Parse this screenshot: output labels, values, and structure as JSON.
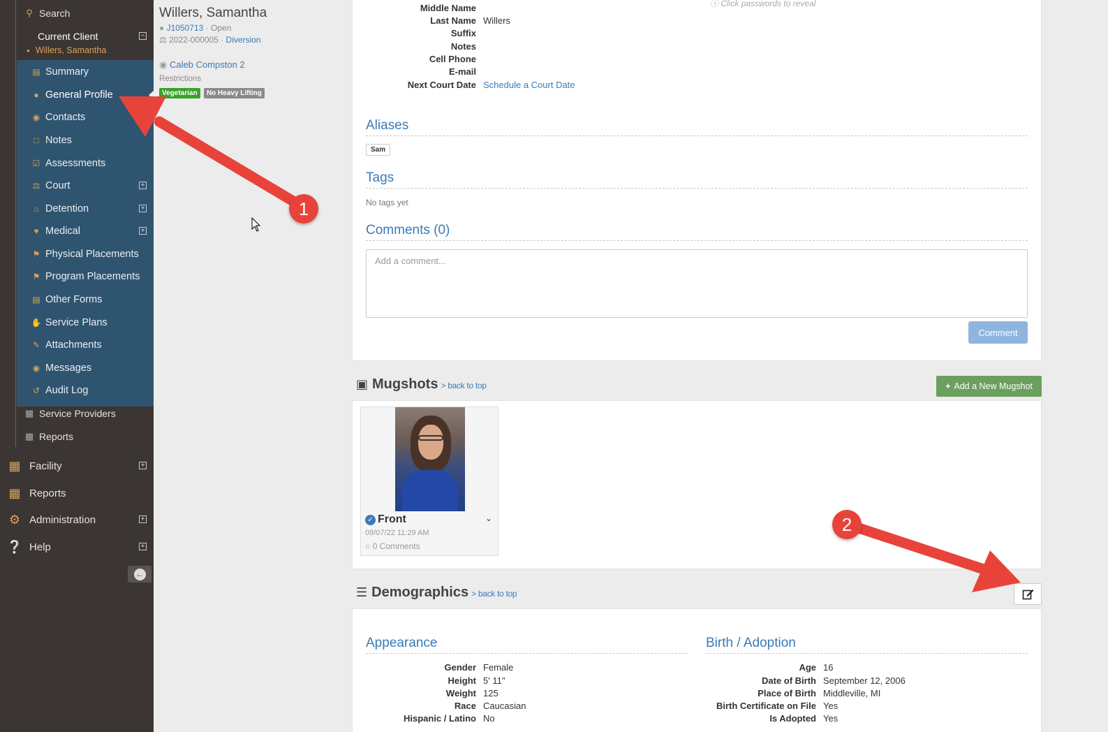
{
  "sidebar": {
    "search_label": "Search",
    "current_client_label": "Current Client",
    "current_client_name": "Willers, Samantha",
    "client_items": [
      {
        "label": "Summary",
        "icon": "list-icon",
        "expandable": false
      },
      {
        "label": "General Profile",
        "icon": "user-icon",
        "expandable": false,
        "active": true
      },
      {
        "label": "Contacts",
        "icon": "users-icon",
        "expandable": false
      },
      {
        "label": "Notes",
        "icon": "note-icon",
        "expandable": false
      },
      {
        "label": "Assessments",
        "icon": "checkbox-icon",
        "expandable": false
      },
      {
        "label": "Court",
        "icon": "scale-icon",
        "expandable": true
      },
      {
        "label": "Detention",
        "icon": "building-columns-icon",
        "expandable": true
      },
      {
        "label": "Medical",
        "icon": "heartbeat-icon",
        "expandable": true
      },
      {
        "label": "Physical Placements",
        "icon": "flag-icon",
        "expandable": false
      },
      {
        "label": "Program Placements",
        "icon": "flag-icon",
        "expandable": false
      },
      {
        "label": "Other Forms",
        "icon": "form-icon",
        "expandable": false
      },
      {
        "label": "Service Plans",
        "icon": "hands-icon",
        "expandable": false
      },
      {
        "label": "Attachments",
        "icon": "paperclip-icon",
        "expandable": false
      },
      {
        "label": "Messages",
        "icon": "chat-icon",
        "expandable": false
      },
      {
        "label": "Audit Log",
        "icon": "history-icon",
        "expandable": false
      }
    ],
    "service_providers_label": "Service Providers",
    "reports_sub_label": "Reports",
    "main_items": [
      {
        "label": "Facility",
        "icon": "building-icon",
        "expandable": true
      },
      {
        "label": "Reports",
        "icon": "table-icon",
        "expandable": false
      },
      {
        "label": "Administration",
        "icon": "cogs-icon",
        "expandable": true
      },
      {
        "label": "Help",
        "icon": "question-icon",
        "expandable": true
      }
    ]
  },
  "client": {
    "name": "Willers, Samantha",
    "id": "J1050713",
    "status": "Open",
    "case_number": "2022-000005",
    "case_type": "Diversion",
    "contact_name": "Caleb Compston 2",
    "restrictions_label": "Restrictions",
    "restrictions": [
      {
        "label": "Vegetarian",
        "color": "#3aa12a"
      },
      {
        "label": "No Heavy Lifting",
        "color": "#8a8a8a"
      }
    ]
  },
  "profile": {
    "password_hint": "Click passwords to reveal",
    "fields": [
      {
        "label": "Middle Name",
        "value": ""
      },
      {
        "label": "Last Name",
        "value": "Willers"
      },
      {
        "label": "Suffix",
        "value": ""
      },
      {
        "label": "Notes",
        "value": ""
      },
      {
        "label": "Cell Phone",
        "value": ""
      },
      {
        "label": "E-mail",
        "value": ""
      },
      {
        "label": "Next Court Date",
        "value": "Schedule a Court Date"
      }
    ],
    "aliases_title": "Aliases",
    "aliases": [
      "Sam"
    ],
    "tags_title": "Tags",
    "tags_empty": "No tags yet",
    "comments_title": "Comments (0)",
    "comment_placeholder": "Add a comment...",
    "comment_button": "Comment"
  },
  "mugshots": {
    "title": "Mugshots",
    "back_to_top": "> back to top",
    "add_button": "Add a New Mugshot",
    "items": [
      {
        "label": "Front",
        "date": "09/07/22 11:29 AM",
        "comments": "0 Comments"
      }
    ]
  },
  "demographics": {
    "title": "Demographics",
    "back_to_top": "> back to top",
    "appearance_title": "Appearance",
    "appearance": [
      {
        "label": "Gender",
        "value": "Female"
      },
      {
        "label": "Height",
        "value": "5' 11\""
      },
      {
        "label": "Weight",
        "value": "125"
      },
      {
        "label": "Race",
        "value": "Caucasian"
      },
      {
        "label": "Hispanic / Latino",
        "value": "No"
      }
    ],
    "birth_title": "Birth / Adoption",
    "birth": [
      {
        "label": "Age",
        "value": "16"
      },
      {
        "label": "Date of Birth",
        "value": "September 12, 2006"
      },
      {
        "label": "Place of Birth",
        "value": "Middleville, MI"
      },
      {
        "label": "Birth Certificate on File",
        "value": "Yes"
      },
      {
        "label": "Is Adopted",
        "value": "Yes"
      }
    ]
  },
  "annotations": {
    "badge_1": "1",
    "badge_2": "2",
    "arrow_color": "#e8433a"
  }
}
